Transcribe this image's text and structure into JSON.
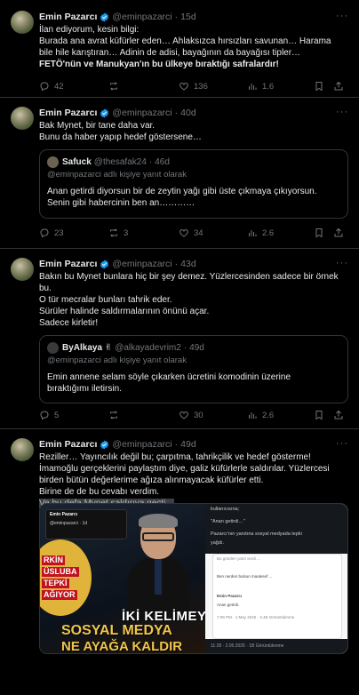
{
  "colors": {
    "background": "#000000",
    "text": "#e7e9ea",
    "muted": "#71767b",
    "border": "#2f3336",
    "verified": "#1d9bf0"
  },
  "tweets": [
    {
      "name": "Emin Pazarcı",
      "handle": "@eminpazarci",
      "time": "15d",
      "lines": [
        "İlan ediyorum, kesin bilgi:",
        "Burada ana avrat küfürler eden… Ahlaksızca hırsızları savunan… Harama",
        "bile hile karıştıran… Adinin de adisi, bayağının da bayağısı tipler…",
        "FETÖ'nün ve Manukyan'ın bu ülkeye bıraktığı safralardır!"
      ],
      "actions": {
        "replies": "42",
        "retweets": "",
        "likes": "136",
        "views": "1.6"
      }
    },
    {
      "name": "Emin Pazarcı",
      "handle": "@eminpazarci",
      "time": "40d",
      "lines": [
        "Bak Mynet, bir tane daha var.",
        "Bunu da haber yapıp hedef göstersene…"
      ],
      "quote": {
        "name": "Safuck",
        "handle": "@thesafak24",
        "time": "46d",
        "replying": "@eminpazarci adlı kişiye yanıt olarak",
        "lines": [
          "Anan getirdi diyorsun bir de zeytin yağı gibi üste çıkmaya çıkıyorsun.",
          "Senin gibi habercinin ben an…………"
        ]
      },
      "actions": {
        "replies": "23",
        "retweets": "3",
        "likes": "34",
        "views": "2.6"
      }
    },
    {
      "name": "Emin Pazarcı",
      "handle": "@eminpazarci",
      "time": "43d",
      "lines": [
        "Bakın bu Mynet bunlara hiç bir şey demez. Yüzlercesinden sadece bir örnek",
        "bu.",
        "O tür mecralar bunları tahrik eder.",
        "Sürüler halinde saldırmalarının önünü açar.",
        "Sadece kirletir!"
      ],
      "quote": {
        "name": "ByAlkaya ✌",
        "handle": "@alkayadevrim2",
        "time": "49d",
        "replying": "@eminpazarci adlı kişiye yanıt olarak",
        "lines": [
          "Emin annene selam söyle çıkarken ücretini komodinin üzerine",
          "bıraktığımı iletirsin."
        ]
      },
      "actions": {
        "replies": "5",
        "retweets": "",
        "likes": "30",
        "views": "2.6"
      }
    },
    {
      "name": "Emin Pazarcı",
      "handle": "@eminpazarci",
      "time": "49d",
      "lines": [
        "Reziller… Yayıncılık değil bu; çarpıtma, tahrikçilik ve hedef gösterme!",
        "İmamoğlu gerçeklerini paylaştım diye, galiz küfürlerle saldırılar. Yüzlercesi",
        "birden bütün değerlerime ağıza alınmayacak küfürler etti.",
        "Birine de de bu cevabı verdim."
      ],
      "highlight": "Ve bu defa Mynet saldırıya geçti…",
      "media": {
        "card_name": "Emin Pazarcı",
        "card_sub": "@eminpazarci · 1d",
        "badge_lines": [
          "RKİN",
          "ÜSLUBA",
          "TEPKİ",
          "AĞIYOR"
        ],
        "banner_1": "İKİ KELİMEY",
        "banner_2": "SOSYAL MEDYA",
        "banner_3": "NE AYAĞA KALDIR",
        "right_lines": [
          "kullanıcısına;",
          "\"Anan getirdi…\"",
          "Pazarcı'nın yanıtına sosyal medyada tepki",
          "yağdı."
        ],
        "inner_lines": [
          "Bu gönderi yanıt verdi ...",
          "Ben nerden bulsun maalesef ...",
          "Emin Pazarcı",
          "Anan getirdi.",
          "7:09 PM · 1 May 2025 · 3.4B Görüntülenme"
        ],
        "footer": "11:28 · 2.05.2025 · 1B Görüntülenme"
      }
    }
  ]
}
